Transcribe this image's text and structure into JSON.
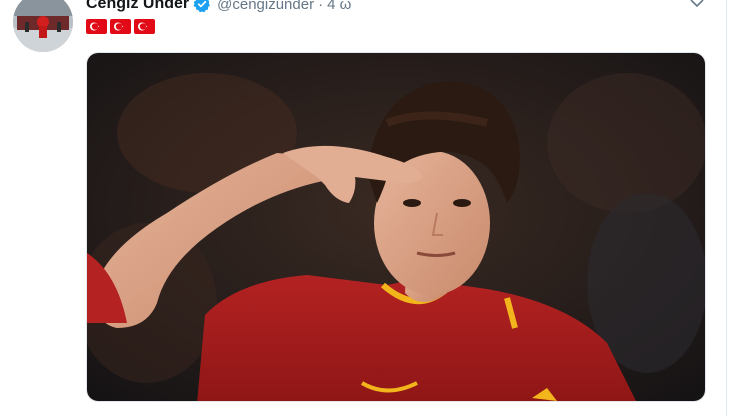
{
  "tweet": {
    "author": {
      "display_name": "Cengiz Ünder",
      "handle": "@cengizunder",
      "verified": true
    },
    "separator": "·",
    "time": "4 ω",
    "flags": [
      "turkey-flag",
      "turkey-flag",
      "turkey-flag"
    ],
    "media": {
      "type": "photo",
      "jersey_color": "#a51c1c",
      "trim_color": "#f2b51b"
    }
  },
  "icons": {
    "verified": "verified-badge-icon",
    "more": "chevron-down-icon"
  },
  "colors": {
    "name": "#14171a",
    "secondary_text": "#657786",
    "verified_blue": "#1da1f2",
    "flag_red": "#e30a17",
    "border": "#e1e8ed"
  }
}
